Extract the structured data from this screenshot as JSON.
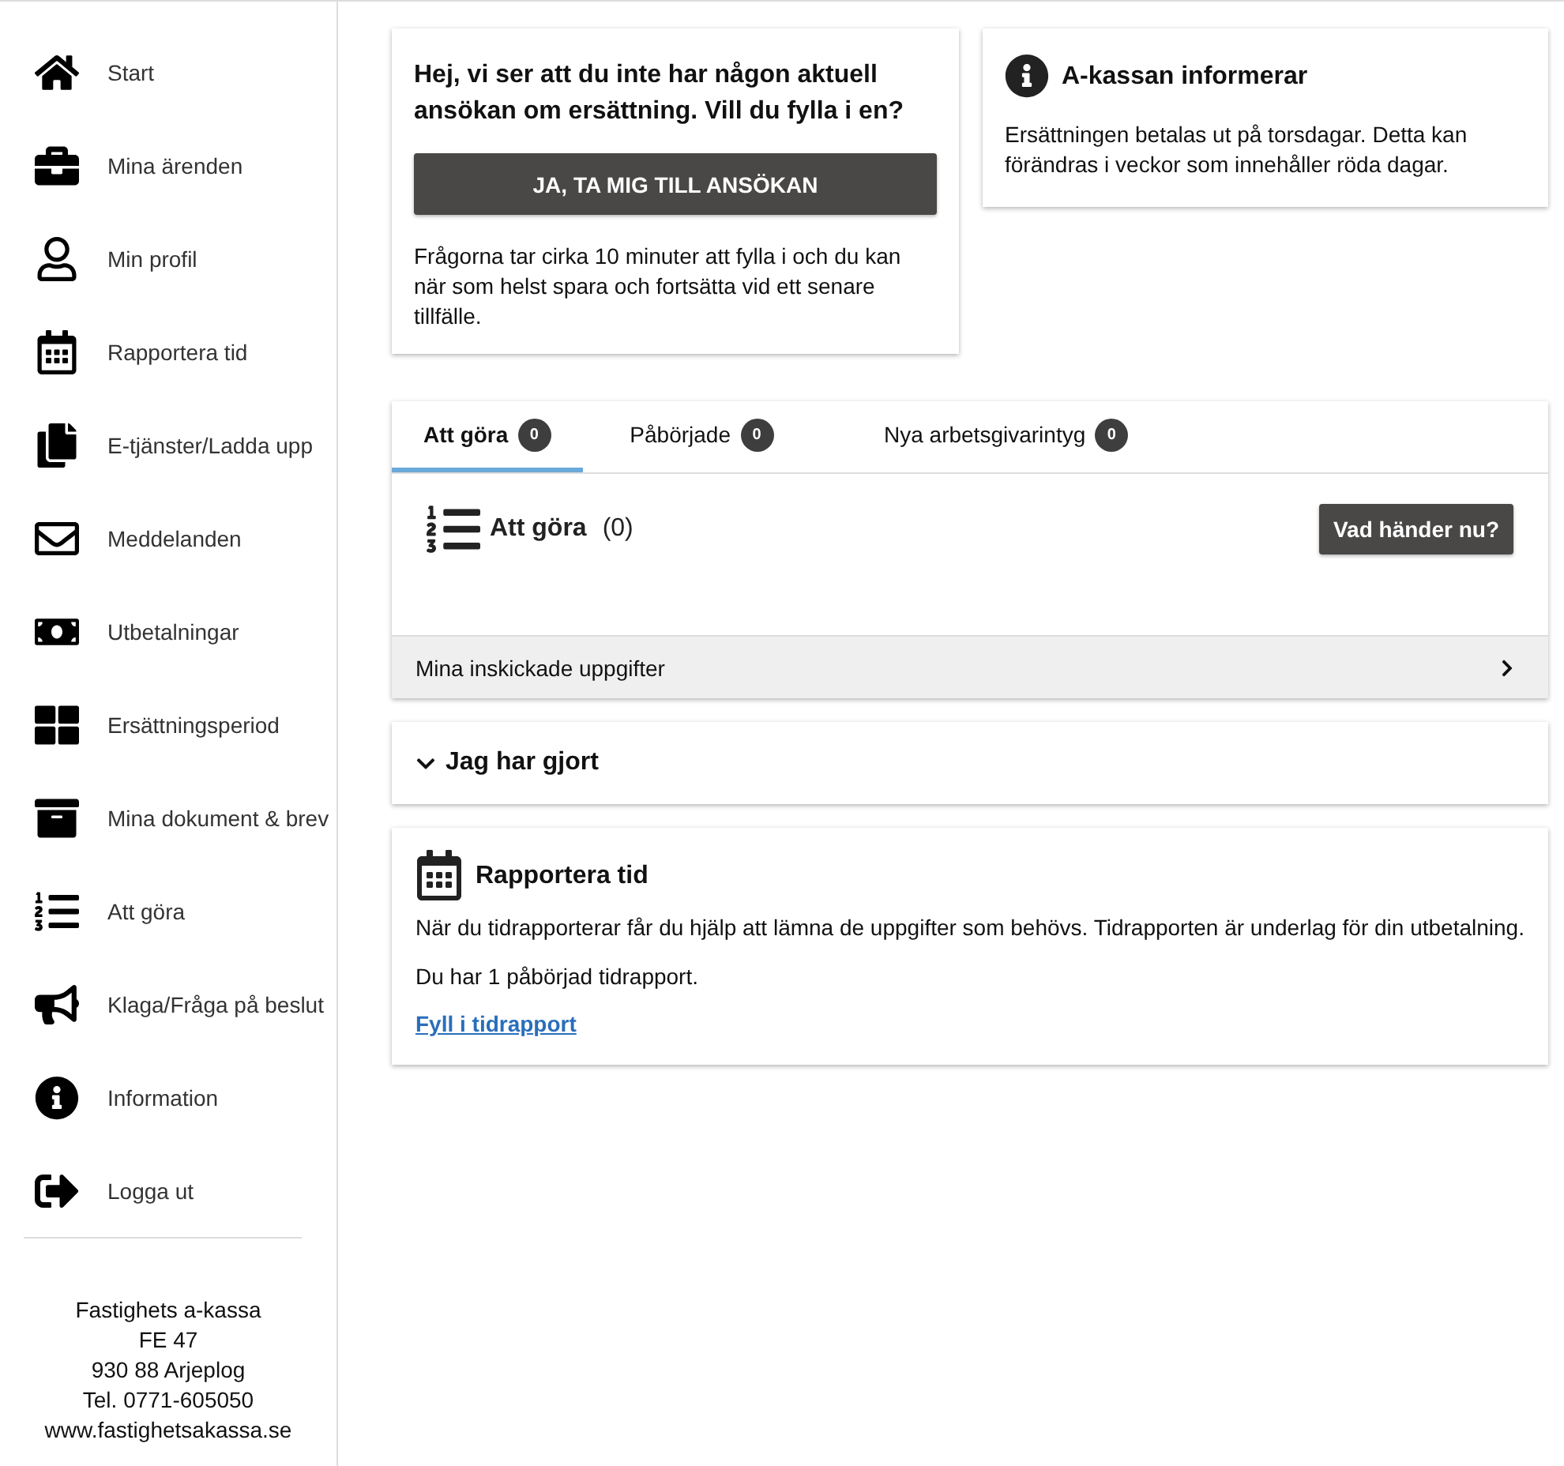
{
  "sidebar": {
    "items": [
      {
        "label": "Start"
      },
      {
        "label": "Mina ärenden"
      },
      {
        "label": "Min profil"
      },
      {
        "label": "Rapportera tid"
      },
      {
        "label": "E-tjänster/Ladda upp"
      },
      {
        "label": "Meddelanden"
      },
      {
        "label": "Utbetalningar"
      },
      {
        "label": "Ersättningsperiod"
      },
      {
        "label": "Mina dokument & brev"
      },
      {
        "label": "Att göra"
      },
      {
        "label": "Klaga/Fråga på beslut"
      },
      {
        "label": "Information"
      },
      {
        "label": "Logga ut"
      }
    ],
    "address": [
      "Fastighets a-kassa",
      "FE 47",
      "930 88 Arjeplog",
      "Tel. 0771-605050",
      "www.fastighetsakassa.se"
    ]
  },
  "application_card": {
    "heading": "Hej, vi ser att du inte har någon aktuell ansökan om ersättning. Vill du fylla i en?",
    "button": "JA, TA MIG TILL ANSÖKAN",
    "text": "Frågorna tar cirka 10 minuter att fylla i och du kan när som helst spara och fortsätta vid ett senare tillfälle."
  },
  "info_card": {
    "title": "A-kassan informerar",
    "text": "Ersättningen betalas ut på torsdagar. Detta kan förändras i veckor som innehåller röda dagar."
  },
  "tasks": {
    "tabs": [
      {
        "label": "Att göra",
        "count": "0",
        "selected": true
      },
      {
        "label": "Påbörjade",
        "count": "0",
        "selected": false
      },
      {
        "label": "Nya arbetsgivarintyg",
        "count": "0",
        "selected": false
      }
    ],
    "title": "Att göra",
    "count": "(0)",
    "help_button": "Vad händer nu?",
    "submitted_row": "Mina inskickade uppgifter"
  },
  "done_section": {
    "title": "Jag har gjort",
    "expanded": false
  },
  "report_card": {
    "title": "Rapportera tid",
    "text": "När du tidrapporterar får du hjälp att lämna de uppgifter som behövs. Tidrapporten är underlag för din utbetalning.",
    "status": "Du har 1 påbörjad tidrapport.",
    "link": "Fyll i tidrapport"
  }
}
